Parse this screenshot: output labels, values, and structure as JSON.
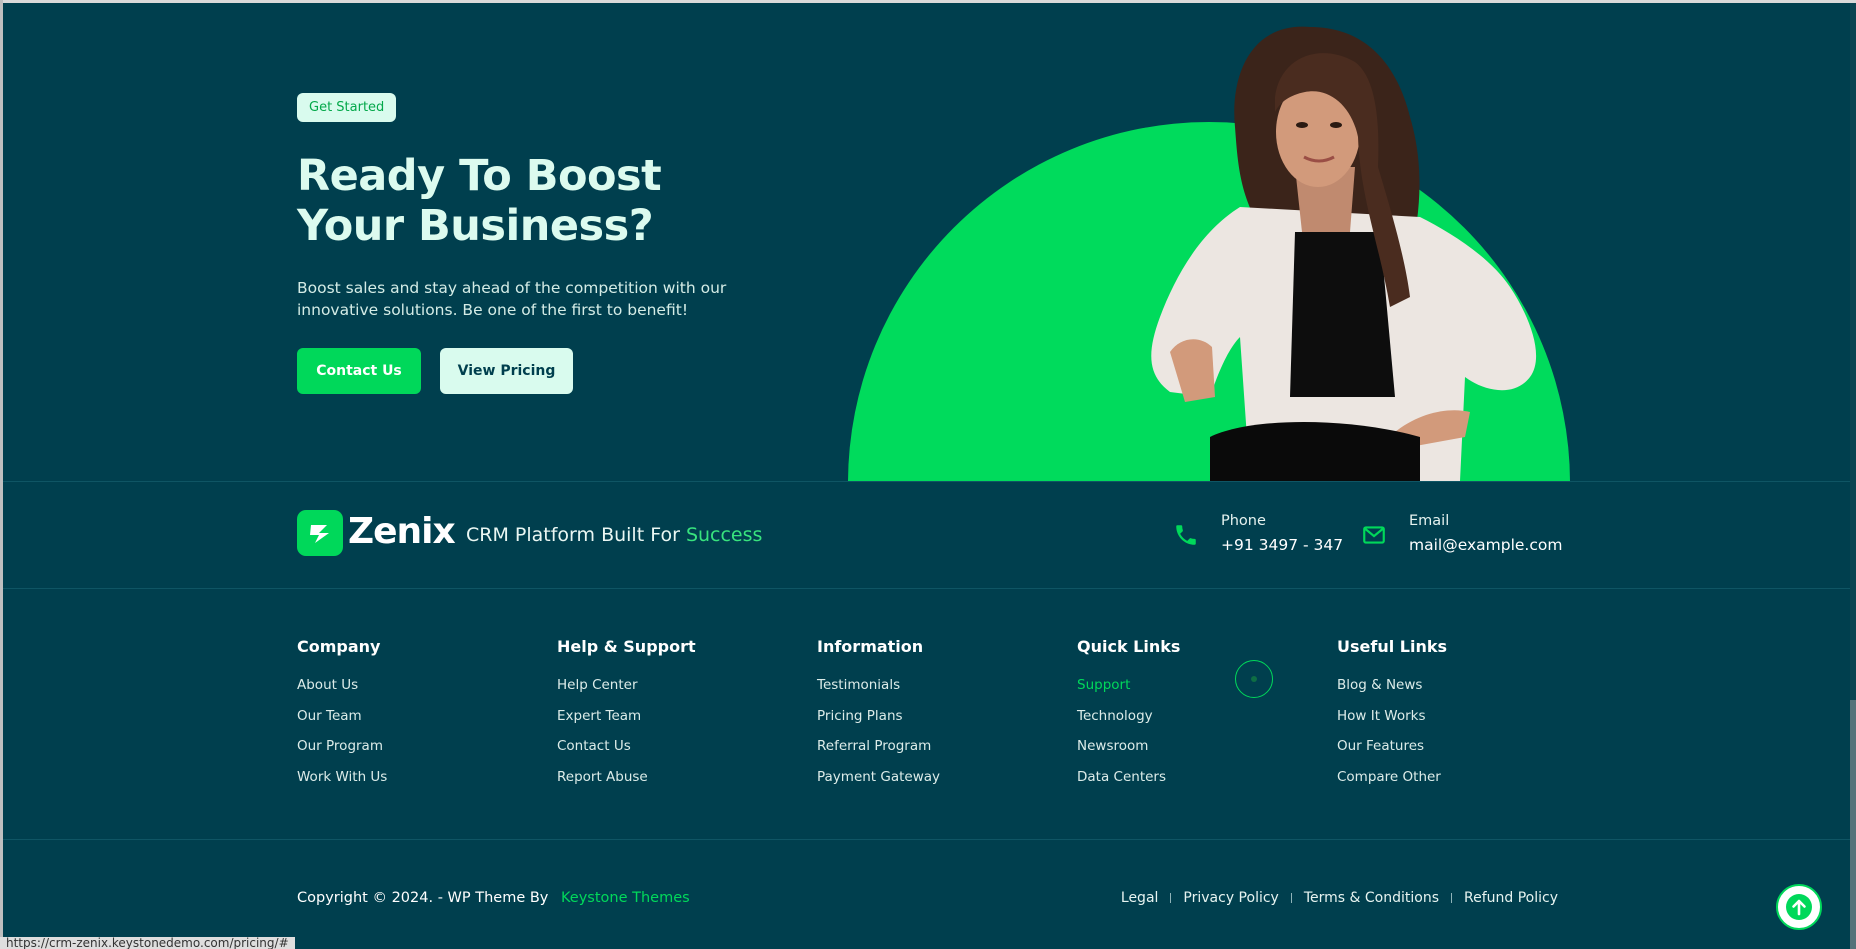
{
  "hero": {
    "badge": "Get Started",
    "title": "Ready To Boost Your Business?",
    "description": "Boost sales and stay ahead of the competition with our innovative solutions. Be one of the first to benefit!",
    "contact_button": "Contact Us",
    "pricing_button": "View Pricing"
  },
  "brand": {
    "logo_text": "Zenix",
    "tagline_prefix": "CRM Platform Built For",
    "tagline_accent": "Success"
  },
  "contact": {
    "phone_label": "Phone",
    "phone_value": "+91 3497 - 347",
    "email_label": "Email",
    "email_value": "mail@example.com"
  },
  "columns": [
    {
      "title": "Company",
      "links": [
        "About Us",
        "Our Team",
        "Our Program",
        "Work With Us"
      ]
    },
    {
      "title": "Help & Support",
      "links": [
        "Help Center",
        "Expert Team",
        "Contact Us",
        "Report Abuse"
      ]
    },
    {
      "title": "Information",
      "links": [
        "Testimonials",
        "Pricing Plans",
        "Referral Program",
        "Payment Gateway"
      ]
    },
    {
      "title": "Quick Links",
      "links": [
        "Support",
        "Technology",
        "Newsroom",
        "Data Centers"
      ]
    },
    {
      "title": "Useful Links",
      "links": [
        "Blog & News",
        "How It Works",
        "Our Features",
        "Compare Other"
      ]
    }
  ],
  "footer": {
    "copyright": "Copyright © 2024. - WP Theme By",
    "theme_brand": "Keystone Themes",
    "legal_links": [
      "Legal",
      "Privacy Policy",
      "Terms & Conditions",
      "Refund Policy"
    ]
  },
  "status_url": "https://crm-zenix.keystonedemo.com/pricing/#",
  "colors": {
    "background": "#003f4e",
    "accent": "#00d85a",
    "badge_bg": "#d9fbee"
  },
  "icons": [
    "phone-icon",
    "mail-icon",
    "arrow-up-icon",
    "logo-icon"
  ]
}
